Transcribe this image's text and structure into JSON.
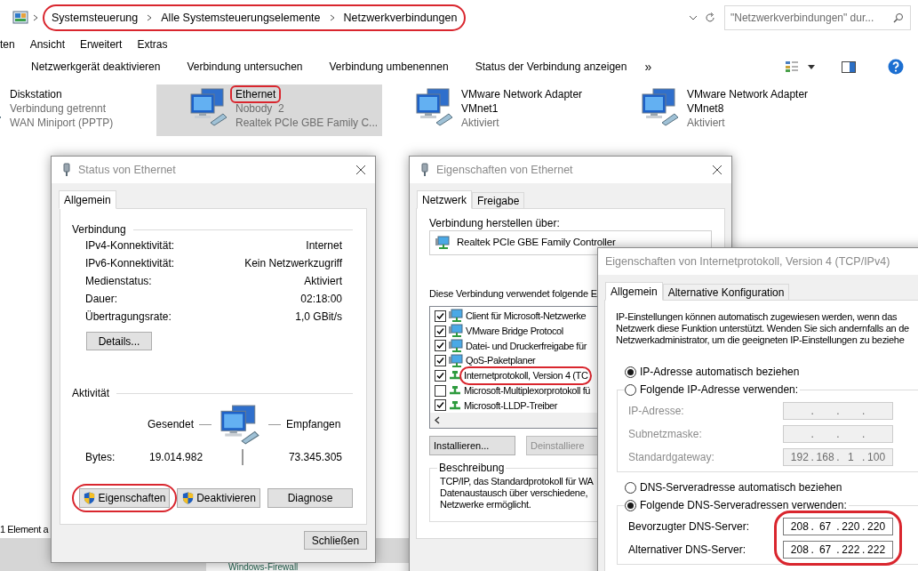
{
  "explorer": {
    "breadcrumbs": [
      "Systemsteuerung",
      "Alle Systemsteuerungselemente",
      "Netzwerkverbindungen"
    ],
    "address_highlighted": true,
    "search": {
      "placeholder": "\"Netzwerkverbindungen\" dur..."
    },
    "menu": [
      "ten",
      "Ansicht",
      "Erweitert",
      "Extras"
    ],
    "toolbar": [
      "Netzwerkgerät deaktivieren",
      "Verbindung untersuchen",
      "Verbindung umbenennen",
      "Status der Verbindung anzeigen"
    ],
    "toolbar_more": "»",
    "connections": [
      {
        "name": "Diskstation",
        "details": [
          "Verbindung getrennt",
          "WAN Miniport (PPTP)"
        ],
        "selected": false,
        "highlighted": false
      },
      {
        "name": "Ethernet",
        "details": [
          "Nobody  2",
          "Realtek PCIe GBE Family C..."
        ],
        "selected": true,
        "highlighted": true
      },
      {
        "name": "VMware Network Adapter VMnet1",
        "details": [
          "Aktiviert"
        ],
        "selected": false,
        "highlighted": false
      },
      {
        "name": "VMware Network Adapter VMnet8",
        "details": [
          "Aktiviert"
        ],
        "selected": false,
        "highlighted": false
      }
    ],
    "status_text": "1 Element a"
  },
  "background_window": {
    "link": "Windows-Firewall"
  },
  "status_dialog": {
    "title": "Status von Ethernet",
    "tabs": [
      {
        "label": "Allgemein",
        "selected": true
      }
    ],
    "connection_heading": "Verbindung",
    "connection_rows": [
      {
        "label": "IPv4-Konnektivität:",
        "value": "Internet"
      },
      {
        "label": "IPv6-Konnektivität:",
        "value": "Kein Netzwerkzugriff"
      },
      {
        "label": "Medienstatus:",
        "value": "Aktiviert"
      },
      {
        "label": "Dauer:",
        "value": "02:18:00"
      },
      {
        "label": "Übertragungsrate:",
        "value": "1,0 GBit/s"
      }
    ],
    "details_button": "Details...",
    "activity_heading": "Aktivität",
    "sent_label": "Gesendet",
    "received_label": "Empfangen",
    "bytes_label": "Bytes:",
    "bytes_sent": "19.014.982",
    "bytes_received": "73.345.305",
    "buttons": [
      {
        "label": "Eigenschaften",
        "shield": true,
        "highlighted": true
      },
      {
        "label": "Deaktivieren",
        "shield": true,
        "highlighted": false
      },
      {
        "label": "Diagnose",
        "shield": false,
        "highlighted": false
      }
    ],
    "close_button": "Schließen"
  },
  "ethernet_dialog": {
    "title": "Eigenschaften von Ethernet",
    "tabs": [
      {
        "label": "Netzwerk",
        "selected": true
      },
      {
        "label": "Freigabe",
        "selected": false
      }
    ],
    "connect_label": "Verbindung herstellen über:",
    "adapter": "Realtek PCIe GBE Family Controller",
    "components_label": "Diese Verbindung verwendet folgende E",
    "components": [
      {
        "label": "Client für Microsoft-Netzwerke",
        "checked": true,
        "kind": "service",
        "highlighted": false
      },
      {
        "label": "VMware Bridge Protocol",
        "checked": true,
        "kind": "service",
        "highlighted": false
      },
      {
        "label": "Datei- und Druckerfreigabe für",
        "checked": true,
        "kind": "service",
        "highlighted": false
      },
      {
        "label": "QoS-Paketplaner",
        "checked": true,
        "kind": "service",
        "highlighted": false
      },
      {
        "label": "Internetprotokoll, Version 4 (TC",
        "checked": true,
        "kind": "protocol",
        "highlighted": true
      },
      {
        "label": "Microsoft-Multiplexorprotokoll fü",
        "checked": false,
        "kind": "protocol",
        "highlighted": false
      },
      {
        "label": "Microsoft-LLDP-Treiber",
        "checked": true,
        "kind": "protocol",
        "highlighted": false
      }
    ],
    "buttons": [
      {
        "label": "Installieren...",
        "disabled": false
      },
      {
        "label": "Deinstalliere",
        "disabled": true
      }
    ],
    "description_heading": "Beschreibung",
    "description_lines": [
      "TCP/IP, das Standardprotokoll für WA",
      "Datenaustausch über verschiedene,",
      "Netzwerke ermöglicht."
    ]
  },
  "ipv4_dialog": {
    "title": "Eigenschaften von Internetprotokoll, Version 4 (TCP/IPv4)",
    "tabs": [
      {
        "label": "Allgemein",
        "selected": true
      },
      {
        "label": "Alternative Konfiguration",
        "selected": false
      }
    ],
    "intro_lines": [
      "IP-Einstellungen können automatisch zugewiesen werden, wenn das",
      "Netzwerk diese Funktion unterstützt. Wenden Sie sich andernfalls an de",
      "Netzwerkadministrator, um die geeigneten IP-Einstellungen zu beziehe"
    ],
    "separator": ".",
    "ip_options": [
      {
        "label": "IP-Adresse automatisch beziehen",
        "selected": true
      },
      {
        "label": "Folgende IP-Adresse verwenden:",
        "selected": false
      }
    ],
    "ip_group": {
      "highlighted": false,
      "fields": [
        {
          "label": "IP-Adresse:",
          "disabled": true
        },
        {
          "label": "Subnetzmaske:",
          "disabled": true
        },
        {
          "label": "Standardgateway:",
          "disabled": true,
          "octets": [
            "192",
            "168",
            "1",
            "100"
          ]
        }
      ]
    },
    "dns_options": [
      {
        "label": "DNS-Serveradresse automatisch beziehen",
        "selected": false
      },
      {
        "label": "Folgende DNS-Serveradressen verwenden:",
        "selected": true
      }
    ],
    "dns_group": {
      "highlighted": true,
      "fields": [
        {
          "label": "Bevorzugter DNS-Server:",
          "disabled": false,
          "octets": [
            "208",
            "67",
            "220",
            "220"
          ]
        },
        {
          "label": "Alternativer DNS-Server:",
          "disabled": false,
          "octets": [
            "208",
            "67",
            "222",
            "222"
          ]
        }
      ]
    }
  }
}
